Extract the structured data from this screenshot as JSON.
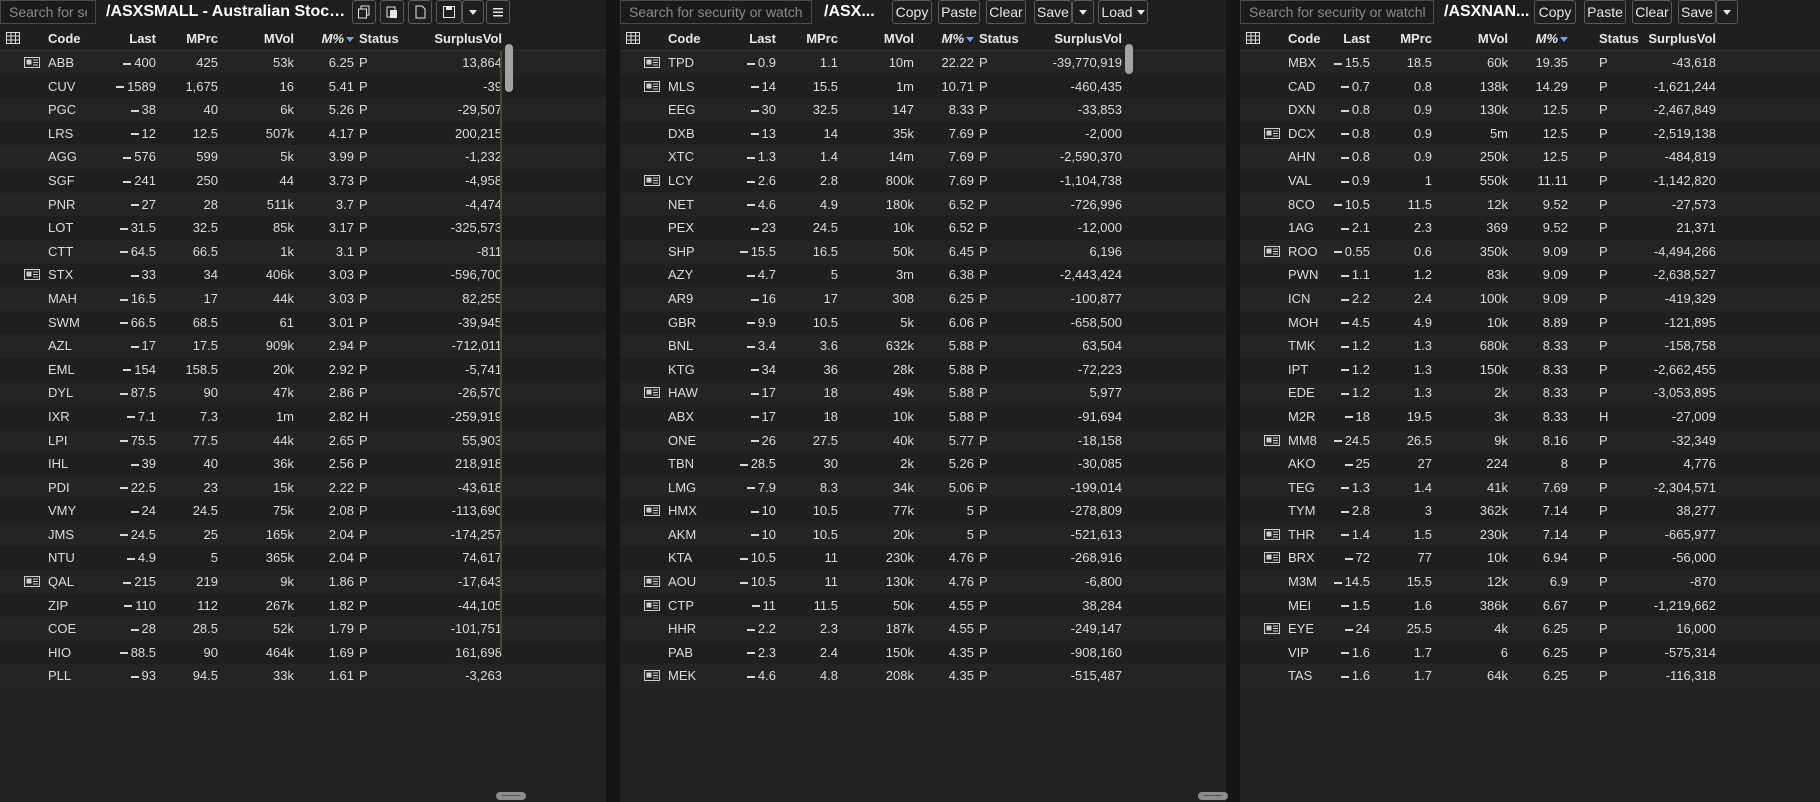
{
  "common": {
    "search_placeholder": "Search for security or watchlist...",
    "search_placeholder_short": "Search for secu",
    "columns": {
      "code": "Code",
      "last": "Last",
      "mprc": "MPrc",
      "mvol": "MVol",
      "mpct": "M%",
      "status": "Status",
      "surplus": "SurplusVol"
    },
    "buttons": {
      "copy": "Copy",
      "paste": "Paste",
      "clear": "Clear",
      "save": "Save",
      "load": "Load"
    }
  },
  "panel1": {
    "title": "/ASXSMALL - Australian Stock Exc...",
    "rows": [
      {
        "news": true,
        "code": "ABB",
        "last": "400",
        "mprc": "425",
        "mvol": "53k",
        "mpct": "6.25",
        "status": "P",
        "surplus": "13,864"
      },
      {
        "news": false,
        "code": "CUV",
        "last": "1589",
        "mprc": "1,675",
        "mvol": "16",
        "mpct": "5.41",
        "status": "P",
        "surplus": "-39"
      },
      {
        "news": false,
        "code": "PGC",
        "last": "38",
        "mprc": "40",
        "mvol": "6k",
        "mpct": "5.26",
        "status": "P",
        "surplus": "-29,507"
      },
      {
        "news": false,
        "code": "LRS",
        "last": "12",
        "mprc": "12.5",
        "mvol": "507k",
        "mpct": "4.17",
        "status": "P",
        "surplus": "200,215"
      },
      {
        "news": false,
        "code": "AGG",
        "last": "576",
        "mprc": "599",
        "mvol": "5k",
        "mpct": "3.99",
        "status": "P",
        "surplus": "-1,232"
      },
      {
        "news": false,
        "code": "SGF",
        "last": "241",
        "mprc": "250",
        "mvol": "44",
        "mpct": "3.73",
        "status": "P",
        "surplus": "-4,958"
      },
      {
        "news": false,
        "code": "PNR",
        "last": "27",
        "mprc": "28",
        "mvol": "511k",
        "mpct": "3.7",
        "status": "P",
        "surplus": "-4,474"
      },
      {
        "news": false,
        "code": "LOT",
        "last": "31.5",
        "mprc": "32.5",
        "mvol": "85k",
        "mpct": "3.17",
        "status": "P",
        "surplus": "-325,573"
      },
      {
        "news": false,
        "code": "CTT",
        "last": "64.5",
        "mprc": "66.5",
        "mvol": "1k",
        "mpct": "3.1",
        "status": "P",
        "surplus": "-811"
      },
      {
        "news": true,
        "code": "STX",
        "last": "33",
        "mprc": "34",
        "mvol": "406k",
        "mpct": "3.03",
        "status": "P",
        "surplus": "-596,700"
      },
      {
        "news": false,
        "code": "MAH",
        "last": "16.5",
        "mprc": "17",
        "mvol": "44k",
        "mpct": "3.03",
        "status": "P",
        "surplus": "82,255"
      },
      {
        "news": false,
        "code": "SWM",
        "last": "66.5",
        "mprc": "68.5",
        "mvol": "61",
        "mpct": "3.01",
        "status": "P",
        "surplus": "-39,945"
      },
      {
        "news": false,
        "code": "AZL",
        "last": "17",
        "mprc": "17.5",
        "mvol": "909k",
        "mpct": "2.94",
        "status": "P",
        "surplus": "-712,011"
      },
      {
        "news": false,
        "code": "EML",
        "last": "154",
        "mprc": "158.5",
        "mvol": "20k",
        "mpct": "2.92",
        "status": "P",
        "surplus": "-5,741"
      },
      {
        "news": false,
        "code": "DYL",
        "last": "87.5",
        "mprc": "90",
        "mvol": "47k",
        "mpct": "2.86",
        "status": "P",
        "surplus": "-26,570"
      },
      {
        "news": false,
        "code": "IXR",
        "last": "7.1",
        "mprc": "7.3",
        "mvol": "1m",
        "mpct": "2.82",
        "status": "H",
        "surplus": "-259,919"
      },
      {
        "news": false,
        "code": "LPI",
        "last": "75.5",
        "mprc": "77.5",
        "mvol": "44k",
        "mpct": "2.65",
        "status": "P",
        "surplus": "55,903"
      },
      {
        "news": false,
        "code": "IHL",
        "last": "39",
        "mprc": "40",
        "mvol": "36k",
        "mpct": "2.56",
        "status": "P",
        "surplus": "218,918"
      },
      {
        "news": false,
        "code": "PDI",
        "last": "22.5",
        "mprc": "23",
        "mvol": "15k",
        "mpct": "2.22",
        "status": "P",
        "surplus": "-43,618"
      },
      {
        "news": false,
        "code": "VMY",
        "last": "24",
        "mprc": "24.5",
        "mvol": "75k",
        "mpct": "2.08",
        "status": "P",
        "surplus": "-113,690"
      },
      {
        "news": false,
        "code": "JMS",
        "last": "24.5",
        "mprc": "25",
        "mvol": "165k",
        "mpct": "2.04",
        "status": "P",
        "surplus": "-174,257"
      },
      {
        "news": false,
        "code": "NTU",
        "last": "4.9",
        "mprc": "5",
        "mvol": "365k",
        "mpct": "2.04",
        "status": "P",
        "surplus": "74,617"
      },
      {
        "news": true,
        "code": "QAL",
        "last": "215",
        "mprc": "219",
        "mvol": "9k",
        "mpct": "1.86",
        "status": "P",
        "surplus": "-17,643"
      },
      {
        "news": false,
        "code": "ZIP",
        "last": "110",
        "mprc": "112",
        "mvol": "267k",
        "mpct": "1.82",
        "status": "P",
        "surplus": "-44,105"
      },
      {
        "news": false,
        "code": "COE",
        "last": "28",
        "mprc": "28.5",
        "mvol": "52k",
        "mpct": "1.79",
        "status": "P",
        "surplus": "-101,751"
      },
      {
        "news": false,
        "code": "HIO",
        "last": "88.5",
        "mprc": "90",
        "mvol": "464k",
        "mpct": "1.69",
        "status": "P",
        "surplus": "161,698"
      },
      {
        "news": false,
        "code": "PLL",
        "last": "93",
        "mprc": "94.5",
        "mvol": "33k",
        "mpct": "1.61",
        "status": "P",
        "surplus": "-3,263"
      }
    ]
  },
  "panel2": {
    "title": "/ASX...",
    "rows": [
      {
        "news": true,
        "code": "TPD",
        "last": "0.9",
        "mprc": "1.1",
        "mvol": "10m",
        "mpct": "22.22",
        "status": "P",
        "surplus": "-39,770,919"
      },
      {
        "news": true,
        "code": "MLS",
        "last": "14",
        "mprc": "15.5",
        "mvol": "1m",
        "mpct": "10.71",
        "status": "P",
        "surplus": "-460,435"
      },
      {
        "news": false,
        "code": "EEG",
        "last": "30",
        "mprc": "32.5",
        "mvol": "147",
        "mpct": "8.33",
        "status": "P",
        "surplus": "-33,853"
      },
      {
        "news": false,
        "code": "DXB",
        "last": "13",
        "mprc": "14",
        "mvol": "35k",
        "mpct": "7.69",
        "status": "P",
        "surplus": "-2,000"
      },
      {
        "news": false,
        "code": "XTC",
        "last": "1.3",
        "mprc": "1.4",
        "mvol": "14m",
        "mpct": "7.69",
        "status": "P",
        "surplus": "-2,590,370"
      },
      {
        "news": true,
        "code": "LCY",
        "last": "2.6",
        "mprc": "2.8",
        "mvol": "800k",
        "mpct": "7.69",
        "status": "P",
        "surplus": "-1,104,738"
      },
      {
        "news": false,
        "code": "NET",
        "last": "4.6",
        "mprc": "4.9",
        "mvol": "180k",
        "mpct": "6.52",
        "status": "P",
        "surplus": "-726,996"
      },
      {
        "news": false,
        "code": "PEX",
        "last": "23",
        "mprc": "24.5",
        "mvol": "10k",
        "mpct": "6.52",
        "status": "P",
        "surplus": "-12,000"
      },
      {
        "news": false,
        "code": "SHP",
        "last": "15.5",
        "mprc": "16.5",
        "mvol": "50k",
        "mpct": "6.45",
        "status": "P",
        "surplus": "6,196"
      },
      {
        "news": false,
        "code": "AZY",
        "last": "4.7",
        "mprc": "5",
        "mvol": "3m",
        "mpct": "6.38",
        "status": "P",
        "surplus": "-2,443,424"
      },
      {
        "news": false,
        "code": "AR9",
        "last": "16",
        "mprc": "17",
        "mvol": "308",
        "mpct": "6.25",
        "status": "P",
        "surplus": "-100,877"
      },
      {
        "news": false,
        "code": "GBR",
        "last": "9.9",
        "mprc": "10.5",
        "mvol": "5k",
        "mpct": "6.06",
        "status": "P",
        "surplus": "-658,500"
      },
      {
        "news": false,
        "code": "BNL",
        "last": "3.4",
        "mprc": "3.6",
        "mvol": "632k",
        "mpct": "5.88",
        "status": "P",
        "surplus": "63,504"
      },
      {
        "news": false,
        "code": "KTG",
        "last": "34",
        "mprc": "36",
        "mvol": "28k",
        "mpct": "5.88",
        "status": "P",
        "surplus": "-72,223"
      },
      {
        "news": true,
        "code": "HAW",
        "last": "17",
        "mprc": "18",
        "mvol": "49k",
        "mpct": "5.88",
        "status": "P",
        "surplus": "5,977"
      },
      {
        "news": false,
        "code": "ABX",
        "last": "17",
        "mprc": "18",
        "mvol": "10k",
        "mpct": "5.88",
        "status": "P",
        "surplus": "-91,694"
      },
      {
        "news": false,
        "code": "ONE",
        "last": "26",
        "mprc": "27.5",
        "mvol": "40k",
        "mpct": "5.77",
        "status": "P",
        "surplus": "-18,158"
      },
      {
        "news": false,
        "code": "TBN",
        "last": "28.5",
        "mprc": "30",
        "mvol": "2k",
        "mpct": "5.26",
        "status": "P",
        "surplus": "-30,085"
      },
      {
        "news": false,
        "code": "LMG",
        "last": "7.9",
        "mprc": "8.3",
        "mvol": "34k",
        "mpct": "5.06",
        "status": "P",
        "surplus": "-199,014"
      },
      {
        "news": true,
        "code": "HMX",
        "last": "10",
        "mprc": "10.5",
        "mvol": "77k",
        "mpct": "5",
        "status": "P",
        "surplus": "-278,809"
      },
      {
        "news": false,
        "code": "AKM",
        "last": "10",
        "mprc": "10.5",
        "mvol": "20k",
        "mpct": "5",
        "status": "P",
        "surplus": "-521,613"
      },
      {
        "news": false,
        "code": "KTA",
        "last": "10.5",
        "mprc": "11",
        "mvol": "230k",
        "mpct": "4.76",
        "status": "P",
        "surplus": "-268,916"
      },
      {
        "news": true,
        "code": "AOU",
        "last": "10.5",
        "mprc": "11",
        "mvol": "130k",
        "mpct": "4.76",
        "status": "P",
        "surplus": "-6,800"
      },
      {
        "news": true,
        "code": "CTP",
        "last": "11",
        "mprc": "11.5",
        "mvol": "50k",
        "mpct": "4.55",
        "status": "P",
        "surplus": "38,284"
      },
      {
        "news": false,
        "code": "HHR",
        "last": "2.2",
        "mprc": "2.3",
        "mvol": "187k",
        "mpct": "4.55",
        "status": "P",
        "surplus": "-249,147"
      },
      {
        "news": false,
        "code": "PAB",
        "last": "2.3",
        "mprc": "2.4",
        "mvol": "150k",
        "mpct": "4.35",
        "status": "P",
        "surplus": "-908,160"
      },
      {
        "news": true,
        "code": "MEK",
        "last": "4.6",
        "mprc": "4.8",
        "mvol": "208k",
        "mpct": "4.35",
        "status": "P",
        "surplus": "-515,487"
      }
    ]
  },
  "panel3": {
    "title": "/ASXNAN...",
    "rows": [
      {
        "news": false,
        "code": "MBX",
        "last": "15.5",
        "mprc": "18.5",
        "mvol": "60k",
        "mpct": "19.35",
        "status": "P",
        "surplus": "-43,618"
      },
      {
        "news": false,
        "code": "CAD",
        "last": "0.7",
        "mprc": "0.8",
        "mvol": "138k",
        "mpct": "14.29",
        "status": "P",
        "surplus": "-1,621,244"
      },
      {
        "news": false,
        "code": "DXN",
        "last": "0.8",
        "mprc": "0.9",
        "mvol": "130k",
        "mpct": "12.5",
        "status": "P",
        "surplus": "-2,467,849"
      },
      {
        "news": true,
        "code": "DCX",
        "last": "0.8",
        "mprc": "0.9",
        "mvol": "5m",
        "mpct": "12.5",
        "status": "P",
        "surplus": "-2,519,138"
      },
      {
        "news": false,
        "code": "AHN",
        "last": "0.8",
        "mprc": "0.9",
        "mvol": "250k",
        "mpct": "12.5",
        "status": "P",
        "surplus": "-484,819"
      },
      {
        "news": false,
        "code": "VAL",
        "last": "0.9",
        "mprc": "1",
        "mvol": "550k",
        "mpct": "11.11",
        "status": "P",
        "surplus": "-1,142,820"
      },
      {
        "news": false,
        "code": "8CO",
        "last": "10.5",
        "mprc": "11.5",
        "mvol": "12k",
        "mpct": "9.52",
        "status": "P",
        "surplus": "-27,573"
      },
      {
        "news": false,
        "code": "1AG",
        "last": "2.1",
        "mprc": "2.3",
        "mvol": "369",
        "mpct": "9.52",
        "status": "P",
        "surplus": "21,371"
      },
      {
        "news": true,
        "code": "ROO",
        "last": "0.55",
        "mprc": "0.6",
        "mvol": "350k",
        "mpct": "9.09",
        "status": "P",
        "surplus": "-4,494,266"
      },
      {
        "news": false,
        "code": "PWN",
        "last": "1.1",
        "mprc": "1.2",
        "mvol": "83k",
        "mpct": "9.09",
        "status": "P",
        "surplus": "-2,638,527"
      },
      {
        "news": false,
        "code": "ICN",
        "last": "2.2",
        "mprc": "2.4",
        "mvol": "100k",
        "mpct": "9.09",
        "status": "P",
        "surplus": "-419,329"
      },
      {
        "news": false,
        "code": "MOH",
        "last": "4.5",
        "mprc": "4.9",
        "mvol": "10k",
        "mpct": "8.89",
        "status": "P",
        "surplus": "-121,895"
      },
      {
        "news": false,
        "code": "TMK",
        "last": "1.2",
        "mprc": "1.3",
        "mvol": "680k",
        "mpct": "8.33",
        "status": "P",
        "surplus": "-158,758"
      },
      {
        "news": false,
        "code": "IPT",
        "last": "1.2",
        "mprc": "1.3",
        "mvol": "150k",
        "mpct": "8.33",
        "status": "P",
        "surplus": "-2,662,455"
      },
      {
        "news": false,
        "code": "EDE",
        "last": "1.2",
        "mprc": "1.3",
        "mvol": "2k",
        "mpct": "8.33",
        "status": "P",
        "surplus": "-3,053,895"
      },
      {
        "news": false,
        "code": "M2R",
        "last": "18",
        "mprc": "19.5",
        "mvol": "3k",
        "mpct": "8.33",
        "status": "H",
        "surplus": "-27,009"
      },
      {
        "news": true,
        "code": "MM8",
        "last": "24.5",
        "mprc": "26.5",
        "mvol": "9k",
        "mpct": "8.16",
        "status": "P",
        "surplus": "-32,349"
      },
      {
        "news": false,
        "code": "AKO",
        "last": "25",
        "mprc": "27",
        "mvol": "224",
        "mpct": "8",
        "status": "P",
        "surplus": "4,776"
      },
      {
        "news": false,
        "code": "TEG",
        "last": "1.3",
        "mprc": "1.4",
        "mvol": "41k",
        "mpct": "7.69",
        "status": "P",
        "surplus": "-2,304,571"
      },
      {
        "news": false,
        "code": "TYM",
        "last": "2.8",
        "mprc": "3",
        "mvol": "362k",
        "mpct": "7.14",
        "status": "P",
        "surplus": "38,277"
      },
      {
        "news": true,
        "code": "THR",
        "last": "1.4",
        "mprc": "1.5",
        "mvol": "230k",
        "mpct": "7.14",
        "status": "P",
        "surplus": "-665,977"
      },
      {
        "news": true,
        "code": "BRX",
        "last": "72",
        "mprc": "77",
        "mvol": "10k",
        "mpct": "6.94",
        "status": "P",
        "surplus": "-56,000"
      },
      {
        "news": false,
        "code": "M3M",
        "last": "14.5",
        "mprc": "15.5",
        "mvol": "12k",
        "mpct": "6.9",
        "status": "P",
        "surplus": "-870"
      },
      {
        "news": false,
        "code": "MEI",
        "last": "1.5",
        "mprc": "1.6",
        "mvol": "386k",
        "mpct": "6.67",
        "status": "P",
        "surplus": "-1,219,662"
      },
      {
        "news": true,
        "code": "EYE",
        "last": "24",
        "mprc": "25.5",
        "mvol": "4k",
        "mpct": "6.25",
        "status": "P",
        "surplus": "16,000"
      },
      {
        "news": false,
        "code": "VIP",
        "last": "1.6",
        "mprc": "1.7",
        "mvol": "6",
        "mpct": "6.25",
        "status": "P",
        "surplus": "-575,314"
      },
      {
        "news": false,
        "code": "TAS",
        "last": "1.6",
        "mprc": "1.7",
        "mvol": "64k",
        "mpct": "6.25",
        "status": "P",
        "surplus": "-116,318"
      }
    ]
  }
}
